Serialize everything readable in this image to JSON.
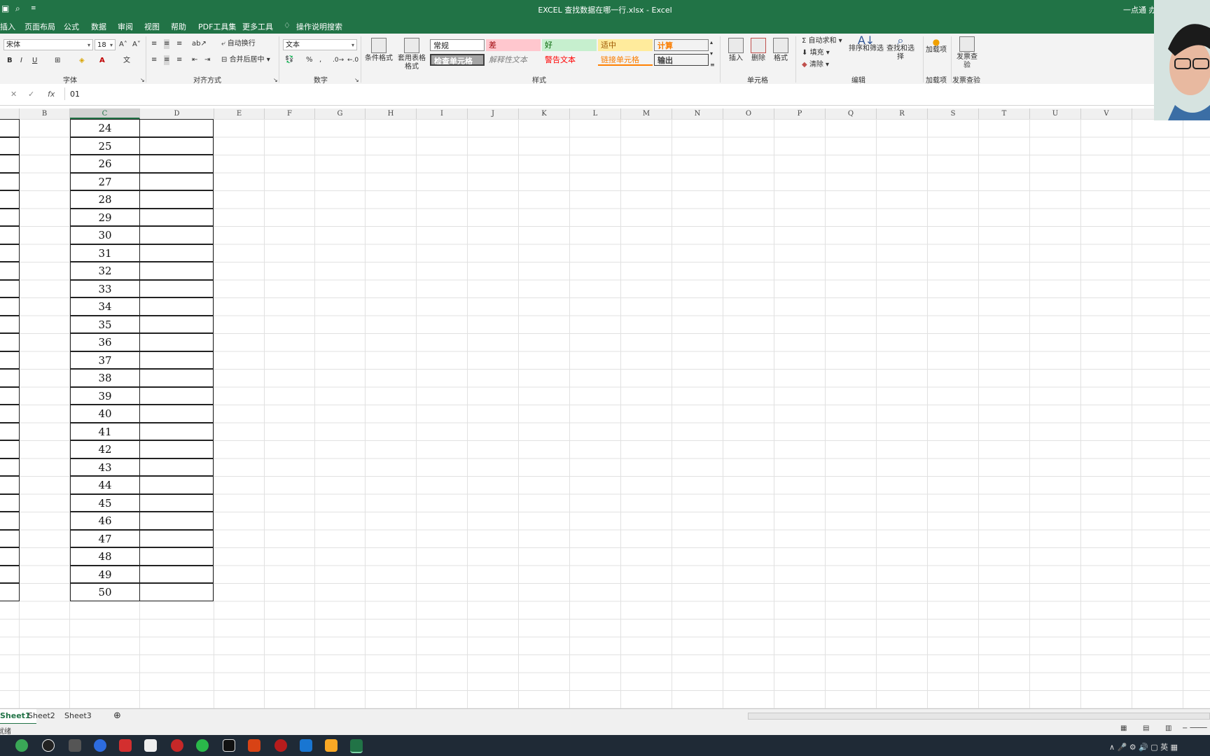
{
  "window": {
    "title": "EXCEL 查找数据在哪一行.xlsx  -  Excel",
    "user": "一点通 办公"
  },
  "menu": [
    "插入",
    "页面布局",
    "公式",
    "数据",
    "审阅",
    "视图",
    "帮助",
    "PDF工具集",
    "更多工具",
    "操作说明搜索"
  ],
  "ribbon": {
    "font_name": "宋体",
    "font_size": "18",
    "wrap_text": "自动换行",
    "merge_center": "合并后居中",
    "number_format": "文本",
    "cond_format": "条件格式",
    "table_format": "套用表格格式",
    "styles": {
      "normal": "常规",
      "bad": "差",
      "good": "好",
      "neutral": "适中",
      "calc": "计算",
      "check": "检查单元格",
      "explain": "解释性文本",
      "warning": "警告文本",
      "link": "链接单元格",
      "output": "输出"
    },
    "insert": "插入",
    "delete": "删除",
    "format": "格式",
    "autosum": "自动求和",
    "fill": "填充",
    "clear": "清除",
    "sort_filter": "排序和筛选",
    "find_select": "查找和选择",
    "addin": "加载项",
    "invoice": "发票查验",
    "groups": {
      "font": "字体",
      "align": "对齐方式",
      "number": "数字",
      "styles": "样式",
      "cells": "单元格",
      "edit": "编辑",
      "addins": "加载项",
      "invoice": "发票查验"
    }
  },
  "formula_bar": {
    "value": "01"
  },
  "columns": [
    "B",
    "C",
    "D",
    "E",
    "F",
    "G",
    "H",
    "I",
    "J",
    "K",
    "L",
    "M",
    "N",
    "O",
    "P",
    "Q",
    "R",
    "S",
    "T",
    "U",
    "V"
  ],
  "cells_c": [
    "24",
    "25",
    "26",
    "27",
    "28",
    "29",
    "30",
    "31",
    "32",
    "33",
    "34",
    "35",
    "36",
    "37",
    "38",
    "39",
    "40",
    "41",
    "42",
    "43",
    "44",
    "45",
    "46",
    "47",
    "48",
    "49",
    "50"
  ],
  "sheets": [
    "Sheet1",
    "Sheet2",
    "Sheet3"
  ],
  "status": "就绪",
  "colors": {
    "excel_green": "#217346"
  }
}
